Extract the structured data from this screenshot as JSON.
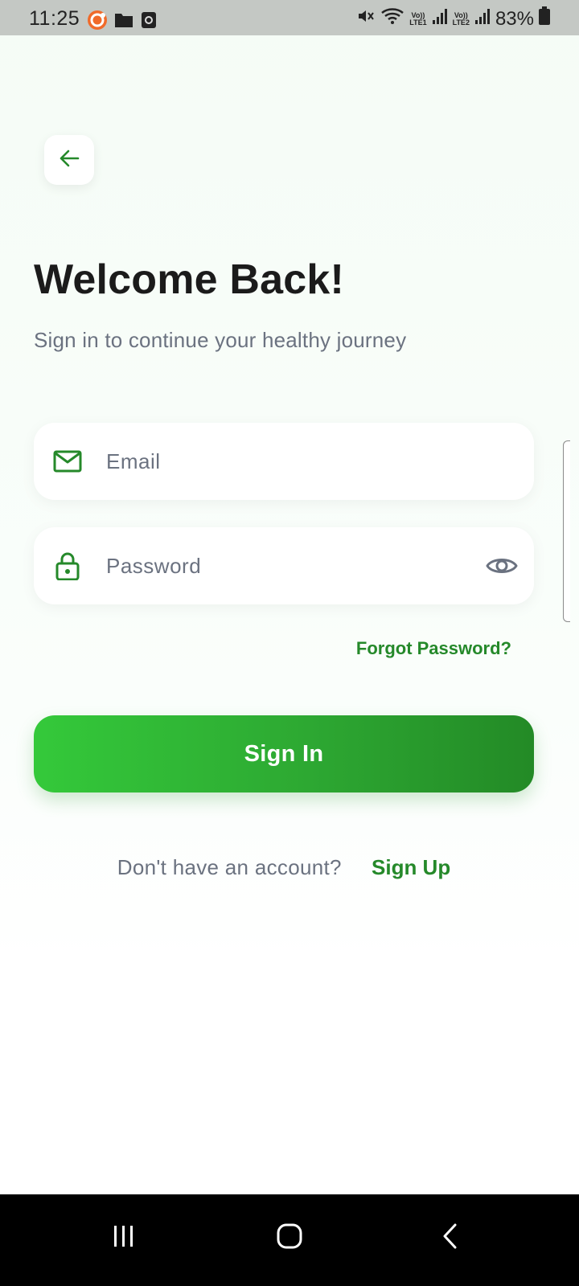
{
  "status_bar": {
    "time": "11:25",
    "battery": "83%",
    "sim1": "LTE1",
    "sim2": "LTE2",
    "left_icons": [
      "camera-badge-icon",
      "folder-icon",
      "screen-record-icon"
    ],
    "right_icons": [
      "mute-icon",
      "wifi-icon",
      "signal-icon",
      "battery-icon"
    ]
  },
  "header": {
    "back_icon": "arrow-left-icon",
    "title": "Welcome Back!",
    "subtitle": "Sign in to continue your healthy journey"
  },
  "form": {
    "email": {
      "placeholder": "Email",
      "value": "",
      "icon": "mail-icon"
    },
    "password": {
      "placeholder": "Password",
      "value": "",
      "icon": "lock-icon",
      "toggle_icon": "eye-icon"
    },
    "forgot_password": "Forgot Password?",
    "submit_label": "Sign In"
  },
  "footer": {
    "prompt": "Don't have an account?",
    "signup_label": "Sign Up"
  },
  "colors": {
    "accent": "#25892a",
    "button_gradient_start": "#34c93a",
    "button_gradient_end": "#238a26",
    "muted_text": "#6b7280",
    "title_text": "#1b1b1b"
  },
  "nav_bar": {
    "buttons": [
      "recents-icon",
      "home-icon",
      "back-icon"
    ]
  }
}
